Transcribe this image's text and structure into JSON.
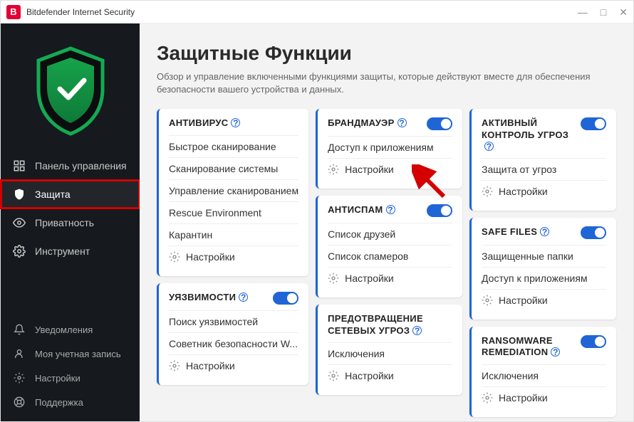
{
  "titlebar": {
    "app_name": "Bitdefender Internet Security"
  },
  "sidebar": {
    "main": [
      {
        "label": "Панель управления",
        "icon": "dashboard"
      },
      {
        "label": "Защита",
        "icon": "shield"
      },
      {
        "label": "Приватность",
        "icon": "eye"
      },
      {
        "label": "Инструмент",
        "icon": "gear"
      }
    ],
    "bottom": [
      {
        "label": "Уведомления",
        "icon": "bell"
      },
      {
        "label": "Моя учетная запись",
        "icon": "user"
      },
      {
        "label": "Настройки",
        "icon": "gear"
      },
      {
        "label": "Поддержка",
        "icon": "lifebuoy"
      }
    ]
  },
  "page": {
    "title": "Защитные Функции",
    "description": "Обзор и управление включенными функциями защиты, которые действуют вместе для обеспечения безопасности вашего устройства и данных."
  },
  "cards": {
    "antivirus": {
      "title": "АНТИВИРУС",
      "rows": [
        "Быстрое сканирование",
        "Сканирование системы",
        "Управление сканированием",
        "Rescue Environment",
        "Карантин"
      ],
      "settings": "Настройки"
    },
    "vuln": {
      "title": "УЯЗВИМОСТИ",
      "rows": [
        "Поиск уязвимостей",
        "Советник безопасности W..."
      ],
      "settings": "Настройки"
    },
    "firewall": {
      "title": "БРАНДМАУЭР",
      "rows": [
        "Доступ к приложениям"
      ],
      "settings": "Настройки"
    },
    "antispam": {
      "title": "АНТИСПАМ",
      "rows": [
        "Список друзей",
        "Список спамеров"
      ],
      "settings": "Настройки"
    },
    "netthreat": {
      "title": "ПРЕДОТВРАЩЕНИЕ СЕТЕВЫХ УГРОЗ",
      "rows": [
        "Исключения"
      ],
      "settings": "Настройки"
    },
    "atc": {
      "title": "АКТИВНЫЙ КОНТРОЛЬ УГРОЗ",
      "rows": [
        "Защита от угроз"
      ],
      "settings": "Настройки"
    },
    "safefiles": {
      "title": "SAFE FILES",
      "rows": [
        "Защищенные папки",
        "Доступ к приложениям"
      ],
      "settings": "Настройки"
    },
    "ransomware": {
      "title": "RANSOMWARE REMEDIATION",
      "rows": [
        "Исключения"
      ],
      "settings": "Настройки"
    }
  }
}
